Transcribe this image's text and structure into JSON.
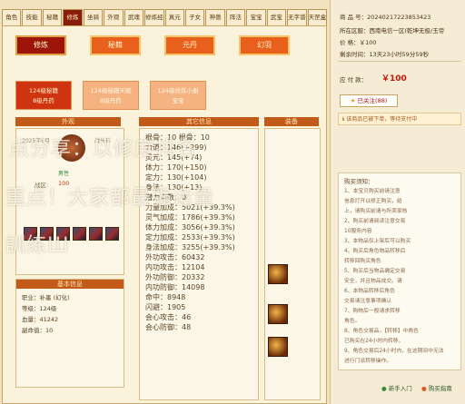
{
  "tabs": [
    "角色",
    "技能",
    "秘籍",
    "修炼",
    "坐骑",
    "外观",
    "武魂",
    "修炼经脉",
    "真元",
    "子女",
    "神兽",
    "阵法",
    "宝宝",
    "武宝",
    "无字谱",
    "天罡盒"
  ],
  "categories": [
    "修炼",
    "秘籍",
    "元丹",
    "幻羽"
  ],
  "servers": [
    {
      "line1": "124级秘籍",
      "line2": "8级丹药"
    },
    {
      "line1": "124级秘籍天赋",
      "line2": "8级丹药"
    },
    {
      "line1": "124级修炼小册",
      "line2": "宝宝"
    }
  ],
  "sections": {
    "left": "外观",
    "middle": "其它信息",
    "right": "装备",
    "basic": "基本信息"
  },
  "profile": {
    "line1": "2025年6月",
    "line2": "战长衫",
    "line3": "战区:",
    "gender": "男性",
    "level": "100"
  },
  "stats": [
    "根骨：10  根骨：10",
    "力道：146(+299)",
    "灵元：145(+74)",
    "体力：170(+150)",
    "定力：130(+104)",
    "身法：130(+13)",
    "潜力点数：0",
    "力量加成：5021(+39.3%)",
    "灵气加成：1786(+39.3%)",
    "体力加成：3056(+39.3%)",
    "定力加成：2533(+39.3%)",
    "身法加成：3255(+39.3%)",
    "外功攻击：60432",
    "内功攻击：12104",
    "外功防御：20332",
    "内功防御：14098",
    "命中：8948",
    "闪避：1905",
    "会心攻击：46",
    "会心防御：48"
  ],
  "basic": {
    "rows": [
      "职业：补墨 (幻化)",
      "等级：124级",
      "血量：41242",
      "副命值：10"
    ]
  },
  "watermark": {
    "line1": "点分享：以修度排名",
    "line2": "重点！大家都最强运量",
    "line3": "訓练Ш"
  },
  "right": {
    "title": "商 品 号：20240217223853423",
    "server": "所在区服：西南电信一区(乾坤无极/玉帝",
    "price_label": "价    格：￥100",
    "time": "剩余时间：13天23小时59分59秒",
    "payable_label": "应 付 款：",
    "payable": "￥100",
    "follow_btn": "已关注(88)",
    "notice": "该商品已被下单，等待支付中",
    "tips_title": "购买须知：",
    "tips": [
      "1、本宝贝购买前请注意",
      "信息打开以修正购买，给",
      "上，请购买前请与所卖家核",
      "2、购买前请阅读注意交易",
      "10服务内容",
      "3、本物品仅上架后可以购买",
      "4、购买后角色物品转移后",
      "转移回购买角色",
      "5、购买后当物品确定交易",
      "安全，并且物品成交。请",
      "6、本物品转移后角色",
      "交易请注意事项确认",
      "7、购物后一般请求转移",
      "角色。",
      "8、角色交易品，【转移】中角色",
      "已购买在24小时内转移，",
      "9、角色交易后24小时内，在这期间中无法",
      "进行门派转移操作。"
    ],
    "help": "新手入门",
    "helper_label": "购买指南"
  }
}
